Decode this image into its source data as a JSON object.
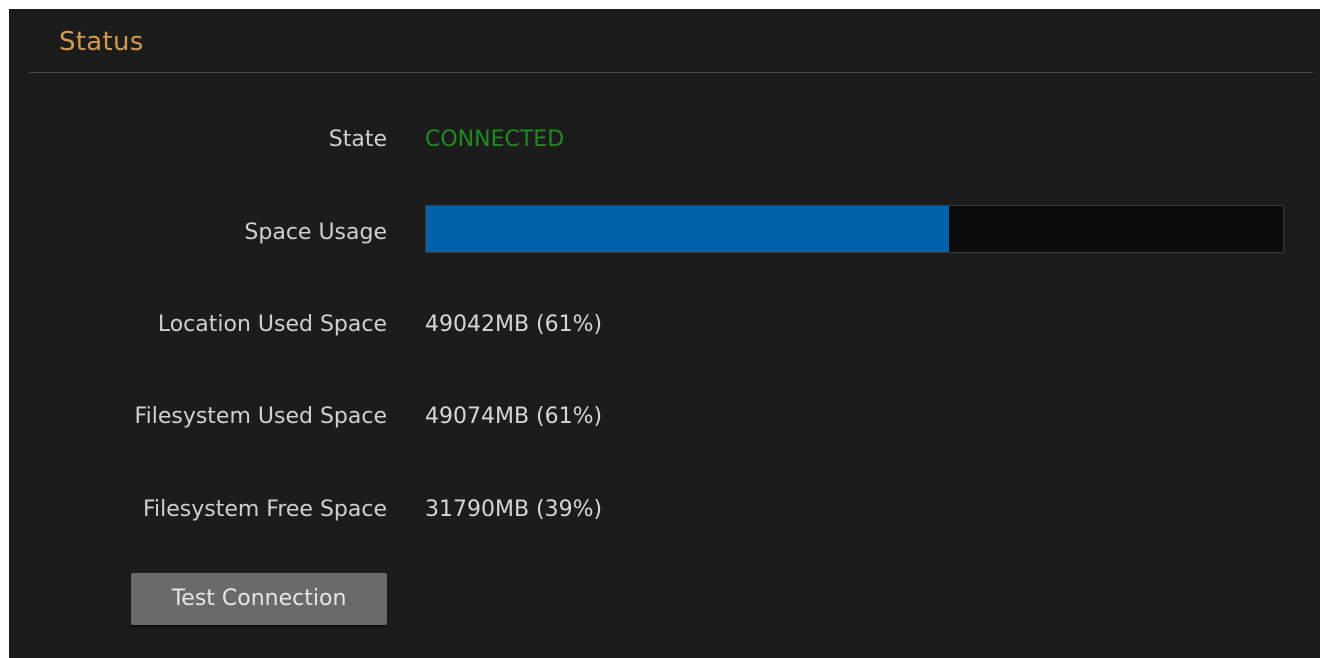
{
  "panel": {
    "title": "Status"
  },
  "rows": [
    {
      "label": "State",
      "value": "CONNECTED"
    },
    {
      "label": "Space Usage"
    },
    {
      "label": "Location Used Space",
      "value": "49042MB (61%)"
    },
    {
      "label": "Filesystem Used Space",
      "value": "49074MB (61%)"
    },
    {
      "label": "Filesystem Free Space",
      "value": "31790MB (39%)"
    }
  ],
  "space_usage": {
    "percent_used": 61
  },
  "buttons": {
    "test_connection": "Test Connection"
  },
  "colors": {
    "background": "#1c1c1c",
    "title": "#d39a4e",
    "connected": "#1f8a1f",
    "progress_fill": "#0062a8",
    "progress_track": "#0b0b0b",
    "button": "#6a6a6a"
  }
}
